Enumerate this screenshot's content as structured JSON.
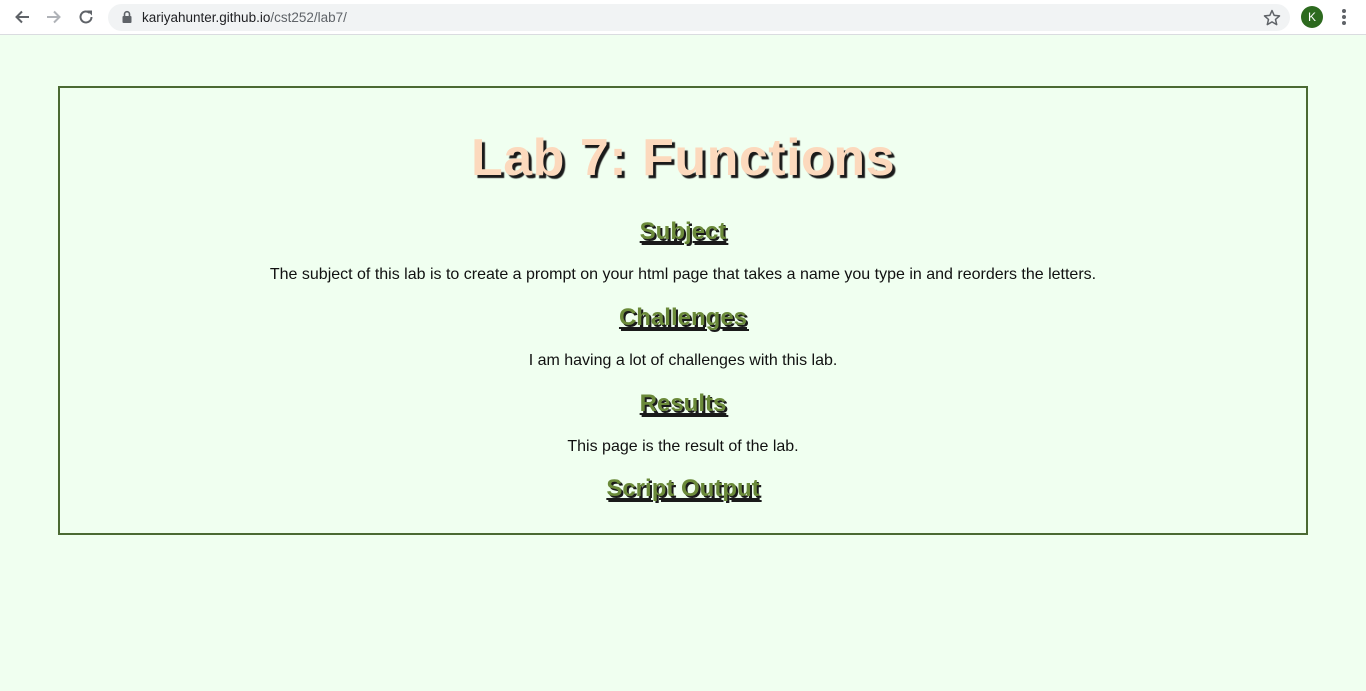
{
  "browser": {
    "url_domain": "kariyahunter.github.io",
    "url_path": "/cst252/lab7/",
    "avatar_letter": "K",
    "icons": {
      "back": "arrow-left-icon",
      "forward": "arrow-right-icon",
      "reload": "reload-icon",
      "lock": "lock-icon",
      "star": "star-icon",
      "menu": "kebab-menu-icon"
    }
  },
  "page": {
    "title": "Lab 7: Functions",
    "sections": [
      {
        "heading": "Subject",
        "text": "The subject of this lab is to create a prompt on your html page that takes a name you type in and reorders the letters."
      },
      {
        "heading": "Challenges",
        "text": "I am having a lot of challenges with this lab."
      },
      {
        "heading": "Results",
        "text": "This page is the result of the lab."
      },
      {
        "heading": "Script Output",
        "text": ""
      }
    ]
  },
  "colors": {
    "background": "#f0fff0",
    "border": "#4b6a33",
    "title": "#fcd9bd",
    "heading": "#6b8a3a",
    "avatar": "#2d6a1f"
  }
}
